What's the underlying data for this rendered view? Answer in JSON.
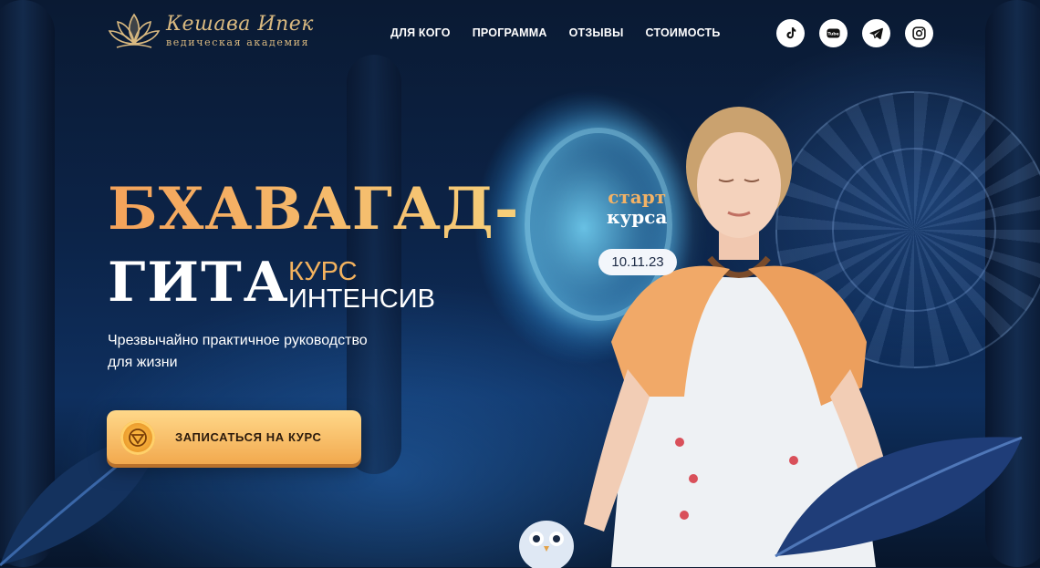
{
  "header": {
    "logo": {
      "title": "Кешава Ипек",
      "subtitle": "ведическая академия"
    },
    "nav": [
      {
        "label": "ДЛЯ КОГО"
      },
      {
        "label": "ПРОГРАММА"
      },
      {
        "label": "ОТЗЫВЫ"
      },
      {
        "label": "СТОИМОСТЬ"
      }
    ],
    "socials": [
      {
        "icon": "tiktok-icon"
      },
      {
        "icon": "youtube-icon"
      },
      {
        "icon": "telegram-icon"
      },
      {
        "icon": "instagram-icon"
      }
    ]
  },
  "hero": {
    "title_line1": "БХАВАГАД-",
    "title_line2": "ГИТА",
    "kurs": "КУРС",
    "intensiv": "ИНТЕНСИВ",
    "subtitle": "Чрезвычайно практичное руководство для жизни",
    "cta_label": "ЗАПИСАТЬСЯ НА КУРС",
    "start_line1": "старт",
    "start_line2": "курса",
    "start_date": "10.11.23"
  },
  "colors": {
    "accent_orange": "#f3b25e",
    "accent_gold": "#d9b980",
    "background_dark": "#0c2347"
  }
}
